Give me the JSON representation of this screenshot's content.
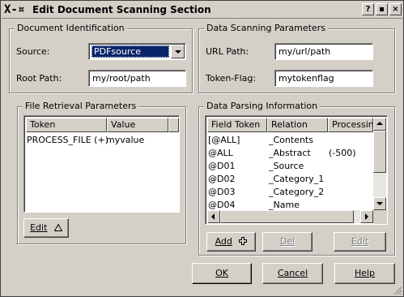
{
  "window": {
    "title": "Edit Document Scanning Section",
    "title_icon": "X-¤",
    "controls": {
      "help": "?",
      "minimize": "▪",
      "close": "×"
    }
  },
  "doc_identification": {
    "label": "Document Identification",
    "source_label": "Source:",
    "source_value": "PDFsource",
    "root_label": "Root Path:",
    "root_value": "my/root/path"
  },
  "data_scanning": {
    "label": "Data Scanning Parameters",
    "url_label": "URL Path:",
    "url_value": "my/url/path",
    "token_label": "Token-Flag:",
    "token_value": "mytokenflag"
  },
  "file_retrieval": {
    "label": "File Retrieval Parameters",
    "columns": [
      "Token",
      "Value"
    ],
    "rows": [
      {
        "token": "PROCESS_FILE (+)",
        "value": "myvalue"
      }
    ],
    "edit_button": "Edit",
    "edit_icon": "triangle-up-icon"
  },
  "data_parsing": {
    "label": "Data Parsing Information",
    "columns": [
      "Field Token",
      "Relation",
      "Processing"
    ],
    "rows": [
      {
        "field": "[@ALL]",
        "relation": "_Contents",
        "processing": ""
      },
      {
        "field": "@ALL",
        "relation": "_Abstract",
        "processing": "(-500)"
      },
      {
        "field": "@D01",
        "relation": "_Source",
        "processing": ""
      },
      {
        "field": "@D02",
        "relation": "_Category_1",
        "processing": ""
      },
      {
        "field": "@D03",
        "relation": "_Category_2",
        "processing": ""
      },
      {
        "field": "@D04",
        "relation": "_Name",
        "processing": ""
      }
    ],
    "add_button": "Add",
    "add_icon": "plus-icon",
    "del_button": "Del",
    "edit_button": "Edit"
  },
  "footer": {
    "ok": "OK",
    "cancel": "Cancel",
    "help": "Help"
  }
}
